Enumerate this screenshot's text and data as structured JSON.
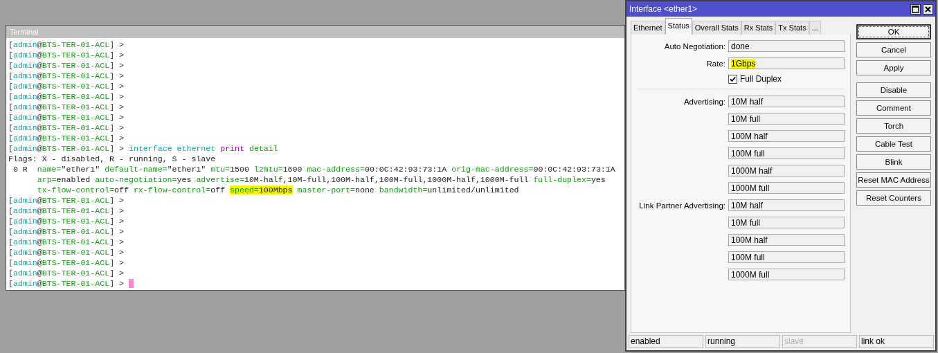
{
  "terminal": {
    "title": "Terminal",
    "lines": [
      [
        {
          "text": "[",
          "kind": "punct"
        },
        {
          "text": "admin",
          "kind": "user"
        },
        {
          "text": "@",
          "kind": "punct"
        },
        {
          "text": "BTS-TER-01-ACL",
          "kind": "host"
        },
        {
          "text": "] >",
          "kind": "punct"
        }
      ],
      [
        {
          "text": "[",
          "kind": "punct"
        },
        {
          "text": "admin",
          "kind": "user"
        },
        {
          "text": "@",
          "kind": "punct"
        },
        {
          "text": "BTS-TER-01-ACL",
          "kind": "host"
        },
        {
          "text": "] >",
          "kind": "punct"
        }
      ],
      [
        {
          "text": "[",
          "kind": "punct"
        },
        {
          "text": "admin",
          "kind": "user"
        },
        {
          "text": "@",
          "kind": "punct"
        },
        {
          "text": "BTS-TER-01-ACL",
          "kind": "host"
        },
        {
          "text": "] >",
          "kind": "punct"
        }
      ],
      [
        {
          "text": "[",
          "kind": "punct"
        },
        {
          "text": "admin",
          "kind": "user"
        },
        {
          "text": "@",
          "kind": "punct"
        },
        {
          "text": "BTS-TER-01-ACL",
          "kind": "host"
        },
        {
          "text": "] >",
          "kind": "punct"
        }
      ],
      [
        {
          "text": "[",
          "kind": "punct"
        },
        {
          "text": "admin",
          "kind": "user"
        },
        {
          "text": "@",
          "kind": "punct"
        },
        {
          "text": "BTS-TER-01-ACL",
          "kind": "host"
        },
        {
          "text": "] >",
          "kind": "punct"
        }
      ],
      [
        {
          "text": "[",
          "kind": "punct"
        },
        {
          "text": "admin",
          "kind": "user"
        },
        {
          "text": "@",
          "kind": "punct"
        },
        {
          "text": "BTS-TER-01-ACL",
          "kind": "host"
        },
        {
          "text": "] >",
          "kind": "punct"
        }
      ],
      [
        {
          "text": "[",
          "kind": "punct"
        },
        {
          "text": "admin",
          "kind": "user"
        },
        {
          "text": "@",
          "kind": "punct"
        },
        {
          "text": "BTS-TER-01-ACL",
          "kind": "host"
        },
        {
          "text": "] >",
          "kind": "punct"
        }
      ],
      [
        {
          "text": "[",
          "kind": "punct"
        },
        {
          "text": "admin",
          "kind": "user"
        },
        {
          "text": "@",
          "kind": "punct"
        },
        {
          "text": "BTS-TER-01-ACL",
          "kind": "host"
        },
        {
          "text": "] >",
          "kind": "punct"
        }
      ],
      [
        {
          "text": "[",
          "kind": "punct"
        },
        {
          "text": "admin",
          "kind": "user"
        },
        {
          "text": "@",
          "kind": "punct"
        },
        {
          "text": "BTS-TER-01-ACL",
          "kind": "host"
        },
        {
          "text": "] >",
          "kind": "punct"
        }
      ],
      [
        {
          "text": "[",
          "kind": "punct"
        },
        {
          "text": "admin",
          "kind": "user"
        },
        {
          "text": "@",
          "kind": "punct"
        },
        {
          "text": "BTS-TER-01-ACL",
          "kind": "host"
        },
        {
          "text": "] >",
          "kind": "punct"
        }
      ],
      [
        {
          "text": "[",
          "kind": "punct"
        },
        {
          "text": "admin",
          "kind": "user"
        },
        {
          "text": "@",
          "kind": "punct"
        },
        {
          "text": "BTS-TER-01-ACL",
          "kind": "host"
        },
        {
          "text": "] > ",
          "kind": "punct"
        },
        {
          "text": "interface ethernet ",
          "kind": "user"
        },
        {
          "text": "print ",
          "kind": "verb"
        },
        {
          "text": "detail",
          "kind": "host"
        }
      ],
      [
        {
          "text": "Flags: X - disabled, R - running, S - slave",
          "kind": "value"
        }
      ],
      [
        {
          "text": " 0 R  ",
          "kind": "value"
        },
        {
          "text": "name=",
          "kind": "key"
        },
        {
          "text": "\"ether1\" ",
          "kind": "value"
        },
        {
          "text": "default-name=",
          "kind": "key"
        },
        {
          "text": "\"ether1\" ",
          "kind": "value"
        },
        {
          "text": "mtu=",
          "kind": "key"
        },
        {
          "text": "1500 ",
          "kind": "value"
        },
        {
          "text": "l2mtu=",
          "kind": "key"
        },
        {
          "text": "1600 ",
          "kind": "value"
        },
        {
          "text": "mac-address=",
          "kind": "key"
        },
        {
          "text": "00:0C:42:93:73:1A ",
          "kind": "value"
        },
        {
          "text": "orig-mac-address=",
          "kind": "key"
        },
        {
          "text": "00:0C:42:93:73:1A",
          "kind": "value"
        }
      ],
      [
        {
          "text": "      arp=",
          "kind": "key"
        },
        {
          "text": "enabled ",
          "kind": "value"
        },
        {
          "text": "auto-negotiation=",
          "kind": "key"
        },
        {
          "text": "yes ",
          "kind": "value"
        },
        {
          "text": "advertise=",
          "kind": "key"
        },
        {
          "text": "10M-half,10M-full,100M-half,100M-full,1000M-half,1000M-full ",
          "kind": "value"
        },
        {
          "text": "full-duplex=",
          "kind": "key"
        },
        {
          "text": "yes",
          "kind": "value"
        }
      ],
      [
        {
          "text": "      tx-flow-control=",
          "kind": "key"
        },
        {
          "text": "off ",
          "kind": "value"
        },
        {
          "text": "rx-flow-control=",
          "kind": "key"
        },
        {
          "text": "off ",
          "kind": "value"
        },
        {
          "text": "speed=",
          "kind": "key",
          "highlighted": true
        },
        {
          "text": "100Mbps",
          "kind": "value",
          "highlighted": true
        },
        {
          "text": " master-port=",
          "kind": "key"
        },
        {
          "text": "none ",
          "kind": "value"
        },
        {
          "text": "bandwidth=",
          "kind": "key"
        },
        {
          "text": "unlimited/unlimited",
          "kind": "value"
        }
      ],
      [
        {
          "text": "[",
          "kind": "punct"
        },
        {
          "text": "admin",
          "kind": "user"
        },
        {
          "text": "@",
          "kind": "punct"
        },
        {
          "text": "BTS-TER-01-ACL",
          "kind": "host"
        },
        {
          "text": "] >",
          "kind": "punct"
        }
      ],
      [
        {
          "text": "[",
          "kind": "punct"
        },
        {
          "text": "admin",
          "kind": "user"
        },
        {
          "text": "@",
          "kind": "punct"
        },
        {
          "text": "BTS-TER-01-ACL",
          "kind": "host"
        },
        {
          "text": "] >",
          "kind": "punct"
        }
      ],
      [
        {
          "text": "[",
          "kind": "punct"
        },
        {
          "text": "admin",
          "kind": "user"
        },
        {
          "text": "@",
          "kind": "punct"
        },
        {
          "text": "BTS-TER-01-ACL",
          "kind": "host"
        },
        {
          "text": "] >",
          "kind": "punct"
        }
      ],
      [
        {
          "text": "[",
          "kind": "punct"
        },
        {
          "text": "admin",
          "kind": "user"
        },
        {
          "text": "@",
          "kind": "punct"
        },
        {
          "text": "BTS-TER-01-ACL",
          "kind": "host"
        },
        {
          "text": "] >",
          "kind": "punct"
        }
      ],
      [
        {
          "text": "[",
          "kind": "punct"
        },
        {
          "text": "admin",
          "kind": "user"
        },
        {
          "text": "@",
          "kind": "punct"
        },
        {
          "text": "BTS-TER-01-ACL",
          "kind": "host"
        },
        {
          "text": "] >",
          "kind": "punct"
        }
      ],
      [
        {
          "text": "[",
          "kind": "punct"
        },
        {
          "text": "admin",
          "kind": "user"
        },
        {
          "text": "@",
          "kind": "punct"
        },
        {
          "text": "BTS-TER-01-ACL",
          "kind": "host"
        },
        {
          "text": "] >",
          "kind": "punct"
        }
      ],
      [
        {
          "text": "[",
          "kind": "punct"
        },
        {
          "text": "admin",
          "kind": "user"
        },
        {
          "text": "@",
          "kind": "punct"
        },
        {
          "text": "BTS-TER-01-ACL",
          "kind": "host"
        },
        {
          "text": "] >",
          "kind": "punct"
        }
      ],
      [
        {
          "text": "[",
          "kind": "punct"
        },
        {
          "text": "admin",
          "kind": "user"
        },
        {
          "text": "@",
          "kind": "punct"
        },
        {
          "text": "BTS-TER-01-ACL",
          "kind": "host"
        },
        {
          "text": "] >",
          "kind": "punct"
        }
      ],
      [
        {
          "text": "[",
          "kind": "punct"
        },
        {
          "text": "admin",
          "kind": "user"
        },
        {
          "text": "@",
          "kind": "punct"
        },
        {
          "text": "BTS-TER-01-ACL",
          "kind": "host"
        },
        {
          "text": "] >",
          "kind": "punct"
        }
      ]
    ],
    "cursor": true
  },
  "dialog": {
    "title": "Interface <ether1>",
    "tabs": [
      {
        "label": "Ethernet",
        "selected": false
      },
      {
        "label": "Status",
        "selected": true
      },
      {
        "label": "Overall Stats",
        "selected": false
      },
      {
        "label": "Rx Stats",
        "selected": false
      },
      {
        "label": "Tx Stats",
        "selected": false
      },
      {
        "label": "...",
        "selected": false
      }
    ],
    "fields": [
      {
        "label": "Auto Negotiation:",
        "value": "done",
        "highlighted": false
      },
      {
        "label": "Rate:",
        "value": "1Gbps",
        "highlighted": true
      }
    ],
    "full_duplex": {
      "label": "Full Duplex",
      "checked": true
    },
    "groups": [
      {
        "label": "Advertising:",
        "values": [
          "10M half",
          "10M full",
          "100M half",
          "100M full",
          "1000M half",
          "1000M full"
        ]
      },
      {
        "label": "Link Partner Advertising:",
        "values": [
          "10M half",
          "10M full",
          "100M half",
          "100M full",
          "1000M full"
        ]
      }
    ],
    "buttons": [
      {
        "label": "OK",
        "focused": true
      },
      {
        "label": "Cancel",
        "focused": false
      },
      {
        "label": "Apply",
        "focused": false
      },
      {
        "label": "Disable",
        "focused": false
      },
      {
        "label": "Comment",
        "focused": false
      },
      {
        "label": "Torch",
        "focused": false
      },
      {
        "label": "Cable Test",
        "focused": false
      },
      {
        "label": "Blink",
        "focused": false
      },
      {
        "label": "Reset MAC Address",
        "focused": false
      },
      {
        "label": "Reset Counters",
        "focused": false
      }
    ],
    "status_bar": [
      {
        "text": "enabled",
        "disabled": false
      },
      {
        "text": "running",
        "disabled": false
      },
      {
        "text": "slave",
        "disabled": true
      },
      {
        "text": "link ok",
        "disabled": false
      }
    ]
  }
}
